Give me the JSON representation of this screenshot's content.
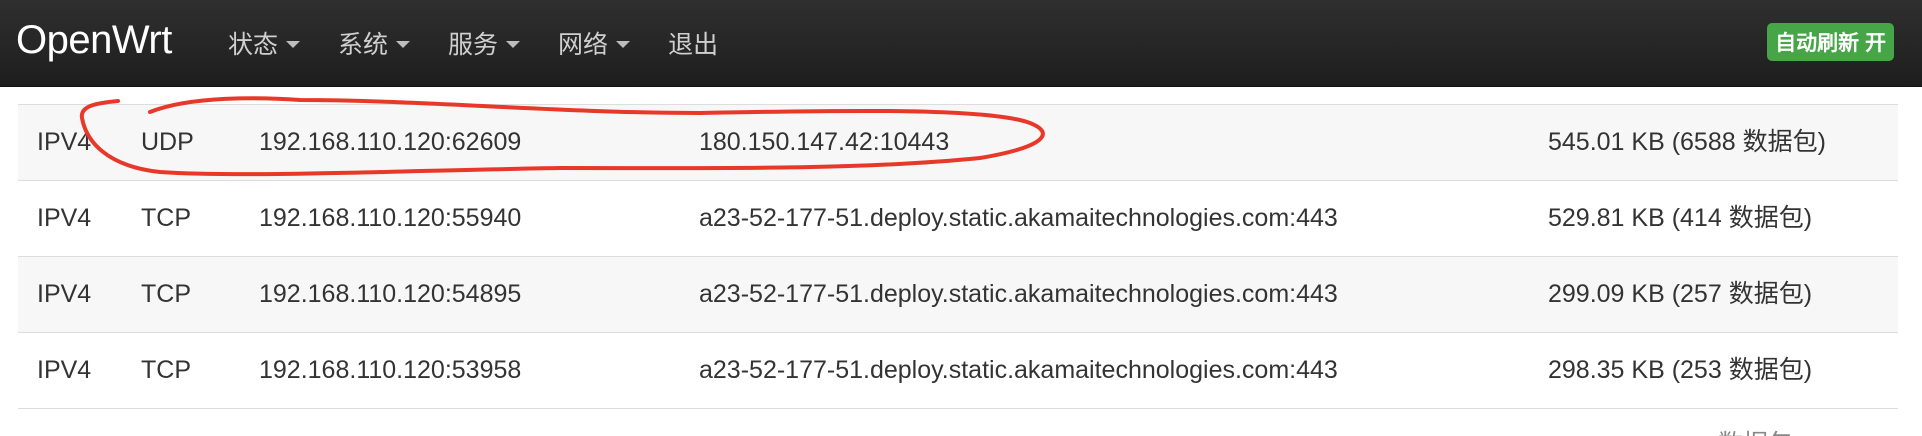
{
  "navbar": {
    "brand": "OpenWrt",
    "menu": [
      {
        "label": "状态",
        "dropdown": true
      },
      {
        "label": "系统",
        "dropdown": true
      },
      {
        "label": "服务",
        "dropdown": true
      },
      {
        "label": "网络",
        "dropdown": true
      },
      {
        "label": "退出",
        "dropdown": false
      }
    ],
    "refresh_badge": "自动刷新 开"
  },
  "connections": [
    {
      "family": "IPV4",
      "protocol": "UDP",
      "source": "192.168.110.120:62609",
      "destination": "180.150.147.42:10443",
      "traffic": "545.01 KB (6588 数据包)"
    },
    {
      "family": "IPV4",
      "protocol": "TCP",
      "source": "192.168.110.120:55940",
      "destination": "a23-52-177-51.deploy.static.akamaitechnologies.com:443",
      "traffic": "529.81 KB (414 数据包)"
    },
    {
      "family": "IPV4",
      "protocol": "TCP",
      "source": "192.168.110.120:54895",
      "destination": "a23-52-177-51.deploy.static.akamaitechnologies.com:443",
      "traffic": "299.09 KB (257 数据包)"
    },
    {
      "family": "IPV4",
      "protocol": "TCP",
      "source": "192.168.110.120:53958",
      "destination": "a23-52-177-51.deploy.static.akamaitechnologies.com:443",
      "traffic": "298.35 KB (253 数据包)"
    }
  ],
  "partial_text": "数据包",
  "colors": {
    "navbar_bg": "#222222",
    "refresh_badge": "#46a546",
    "annotation": "#e8382a"
  }
}
